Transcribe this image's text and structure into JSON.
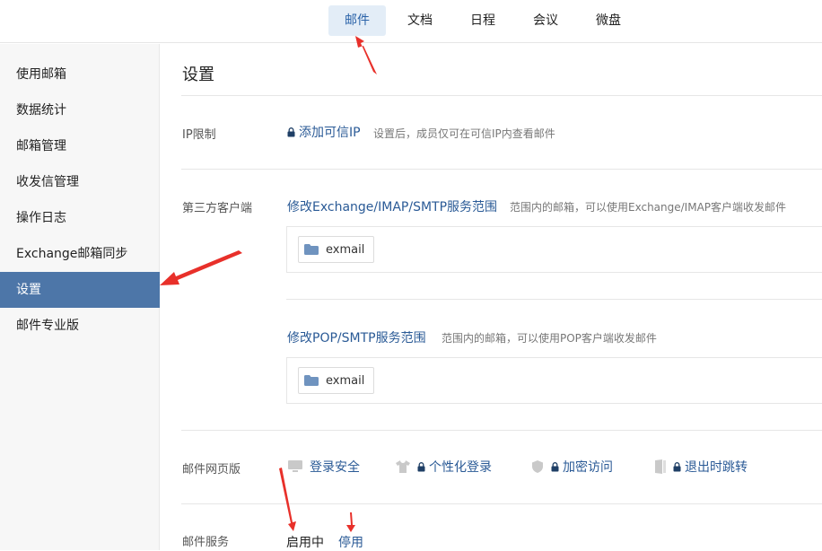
{
  "topnav": {
    "tabs": [
      {
        "label": "邮件",
        "active": true
      },
      {
        "label": "文档",
        "active": false
      },
      {
        "label": "日程",
        "active": false
      },
      {
        "label": "会议",
        "active": false
      },
      {
        "label": "微盘",
        "active": false
      }
    ]
  },
  "sidebar": {
    "items": [
      {
        "label": "使用邮箱"
      },
      {
        "label": "数据统计"
      },
      {
        "label": "邮箱管理"
      },
      {
        "label": "收发信管理"
      },
      {
        "label": "操作日志"
      },
      {
        "label": "Exchange邮箱同步"
      },
      {
        "label": "设置",
        "active": true
      },
      {
        "label": "邮件专业版"
      }
    ]
  },
  "main": {
    "title": "设置",
    "ip": {
      "label": "IP限制",
      "link": "添加可信IP",
      "hint": "设置后，成员仅可在可信IP内查看邮件"
    },
    "client": {
      "label": "第三方客户端",
      "exchange_link": "修改Exchange/IMAP/SMTP服务范围",
      "exchange_hint": "范围内的邮箱，可以使用Exchange/IMAP客户端收发邮件",
      "exchange_tag": "exmail",
      "pop_link": "修改POP/SMTP服务范围",
      "pop_hint": "范围内的邮箱，可以使用POP客户端收发邮件",
      "pop_tag": "exmail"
    },
    "web": {
      "label": "邮件网页版",
      "options": [
        {
          "label": "登录安全",
          "icon": "monitor-icon"
        },
        {
          "label": "个性化登录",
          "icon": "shirt-icon"
        },
        {
          "label": "加密访问",
          "icon": "shield-icon"
        },
        {
          "label": "退出时跳转",
          "icon": "door-icon"
        }
      ]
    },
    "service": {
      "label": "邮件服务",
      "status": "启用中",
      "disable": "停用"
    }
  },
  "colors": {
    "accent": "#4d76a8",
    "link": "#2a5a96",
    "annotation": "#e8302a"
  }
}
